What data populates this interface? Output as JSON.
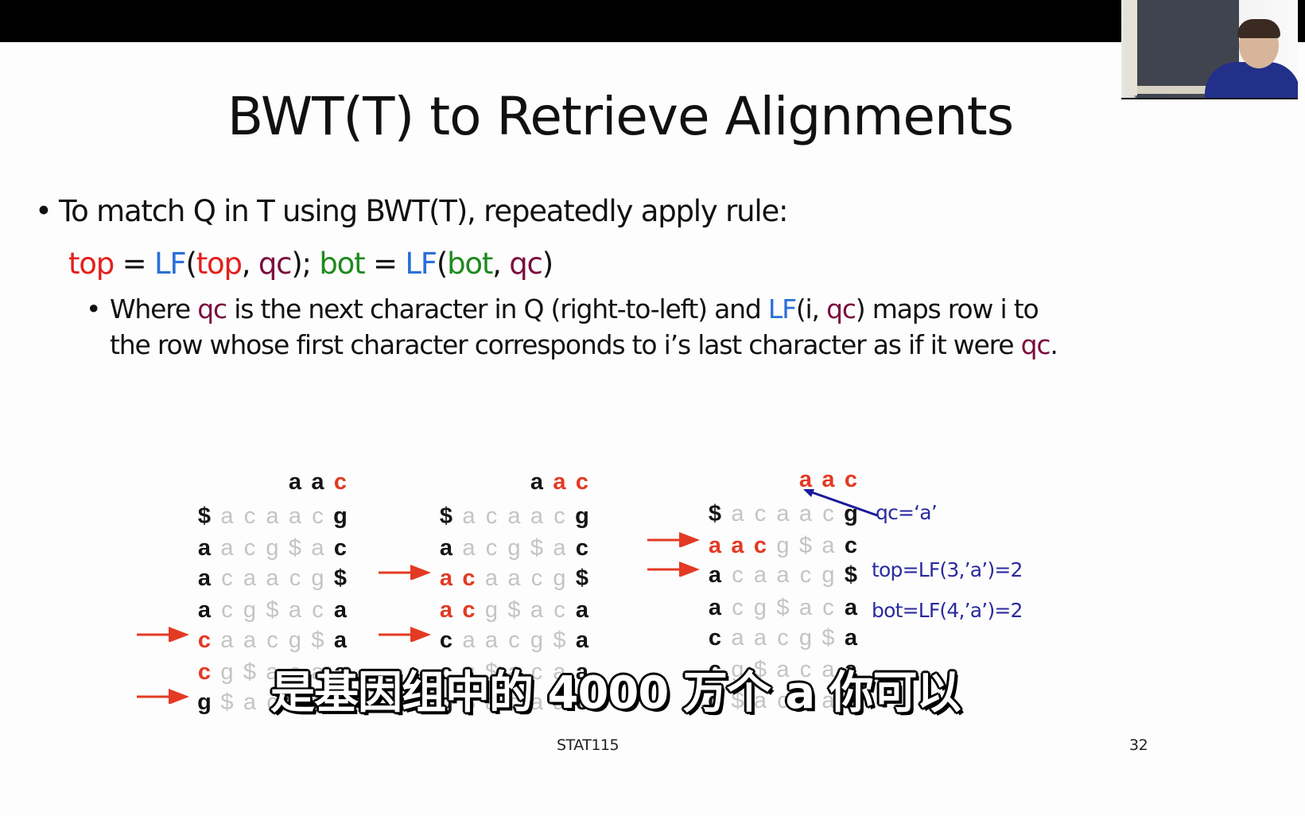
{
  "slide": {
    "title": "BWT(T) to Retrieve Alignments",
    "bullet1": "To match Q in T using BWT(T), repeatedly apply rule:",
    "rule": [
      {
        "text": "top",
        "role": "top"
      },
      {
        "text": " = ",
        "role": "plain"
      },
      {
        "text": "LF",
        "role": "lf"
      },
      {
        "text": "(",
        "role": "plain"
      },
      {
        "text": "top",
        "role": "top"
      },
      {
        "text": ", ",
        "role": "plain"
      },
      {
        "text": "qc",
        "role": "qc"
      },
      {
        "text": "); ",
        "role": "plain"
      },
      {
        "text": "bot",
        "role": "bot"
      },
      {
        "text": " = ",
        "role": "plain"
      },
      {
        "text": "LF",
        "role": "lf"
      },
      {
        "text": "(",
        "role": "plain"
      },
      {
        "text": "bot",
        "role": "bot"
      },
      {
        "text": ", ",
        "role": "plain"
      },
      {
        "text": "qc",
        "role": "qc"
      },
      {
        "text": ")",
        "role": "plain"
      }
    ],
    "sub_bullet": {
      "line1": [
        {
          "text": "Where ",
          "role": "plain"
        },
        {
          "text": "qc",
          "role": "qc"
        },
        {
          "text": " is the next character in Q (right-to-left) and ",
          "role": "plain"
        },
        {
          "text": "LF",
          "role": "lf"
        },
        {
          "text": "(i, ",
          "role": "plain"
        },
        {
          "text": "qc",
          "role": "qc"
        },
        {
          "text": ") maps row i to",
          "role": "plain"
        }
      ],
      "line2": [
        {
          "text": "the row whose first character corresponds to i’s last character as if it were ",
          "role": "plain"
        },
        {
          "text": "qc",
          "role": "qc"
        },
        {
          "text": ".",
          "role": "plain"
        }
      ]
    },
    "colors": {
      "top": "#e3201b",
      "lf": "#2b6fd8",
      "qc": "#7b0d3f",
      "bot": "#1e8a1e",
      "highlight_red": "#e33a23",
      "annotation_blue": "#2a2aa0"
    },
    "bwm_rows": [
      "$acaacg",
      "aacg$ac",
      "acaacg$",
      "acg$aca",
      "caacg$a",
      "cg$acaa",
      "g$acaac"
    ],
    "panels": [
      {
        "query": "aac",
        "query_red": [
          false,
          false,
          true
        ],
        "arrow_rows": [
          4,
          6
        ],
        "red_prefix": [
          0,
          0,
          0,
          0,
          1,
          1,
          0
        ]
      },
      {
        "query": "aac",
        "query_red": [
          false,
          true,
          true
        ],
        "arrow_rows": [
          2,
          4
        ],
        "red_prefix": [
          0,
          0,
          2,
          2,
          0,
          0,
          0
        ]
      },
      {
        "query": "aac",
        "query_red": [
          true,
          true,
          true
        ],
        "arrow_rows": [
          1,
          2
        ],
        "red_prefix": [
          0,
          3,
          0,
          0,
          0,
          0,
          0
        ],
        "annotations": {
          "qc": "qc=‘a’",
          "top": "top=LF(3,’a’)=2",
          "bot": "bot=LF(4,’a’)=2"
        }
      }
    ],
    "footer": {
      "course": "STAT115",
      "page_number": "32"
    }
  },
  "overlay": {
    "subtitle": "是基因组中的 4000 万个 a 你可以"
  },
  "video": {
    "label": "speaker-video"
  }
}
